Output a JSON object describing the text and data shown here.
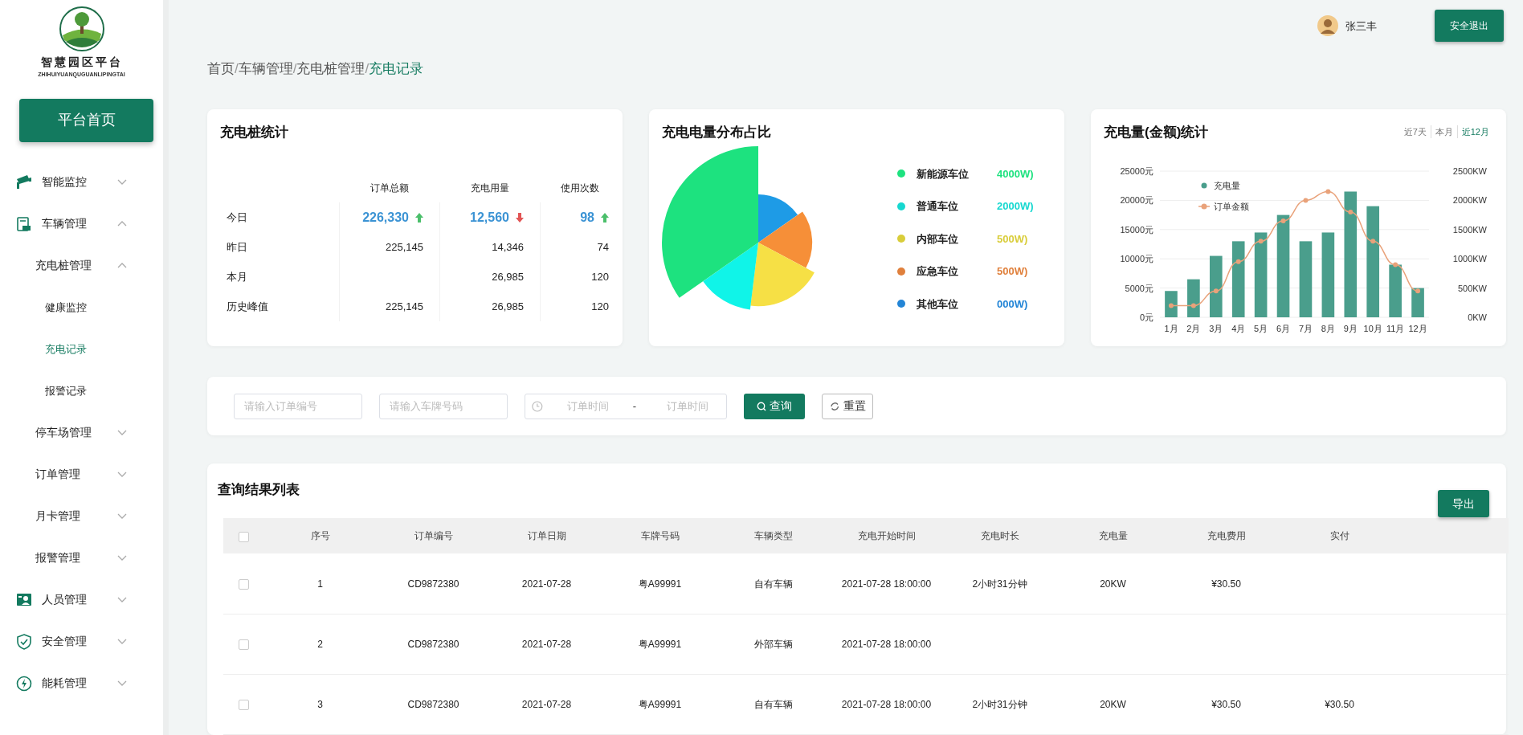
{
  "logo": {
    "title": "智慧园区平台",
    "subtitle": "ZHIHUIYUANQUGUANLIPINGTAI"
  },
  "home_button": "平台首页",
  "sidebar": {
    "items": [
      {
        "label": "智能监控",
        "expanded": false,
        "selected": false
      },
      {
        "label": "车辆管理",
        "expanded": true,
        "selected": false,
        "children": [
          {
            "label": "充电桩管理",
            "expanded": true,
            "selected": false,
            "children": [
              {
                "label": "健康监控",
                "selected": false
              },
              {
                "label": "充电记录",
                "selected": true
              },
              {
                "label": "报警记录",
                "selected": false
              }
            ]
          },
          {
            "label": "停车场管理",
            "expanded": false,
            "selected": false
          },
          {
            "label": "订单管理",
            "expanded": false,
            "selected": false
          },
          {
            "label": "月卡管理",
            "expanded": false,
            "selected": false
          },
          {
            "label": "报警管理",
            "expanded": false,
            "selected": false
          }
        ]
      },
      {
        "label": "人员管理",
        "expanded": false,
        "selected": false
      },
      {
        "label": "安全管理",
        "expanded": false,
        "selected": false
      },
      {
        "label": "能耗管理",
        "expanded": false,
        "selected": false
      }
    ]
  },
  "user": {
    "name": "张三丰",
    "logout": "安全退出"
  },
  "breadcrumb": {
    "separator": "/",
    "items": [
      "首页",
      "车辆管理",
      "充电桩管理",
      "充电记录"
    ]
  },
  "stats": {
    "title": "充电桩统计",
    "columns": [
      "订单总额",
      "充电用量",
      "使用次数"
    ],
    "rows": [
      {
        "label": "今日",
        "highlight": true,
        "cells": [
          {
            "value": "226,330",
            "rising": true
          },
          {
            "value": "12,560",
            "rising": false
          },
          {
            "value": "98",
            "rising": true
          }
        ]
      },
      {
        "label": "昨日",
        "highlight": false,
        "cells": [
          {
            "value": "225,145"
          },
          {
            "value": "14,346"
          },
          {
            "value": "74"
          }
        ]
      },
      {
        "label": "本月",
        "highlight": false,
        "cells": [
          null,
          {
            "value": "26,985"
          },
          {
            "value": "120"
          }
        ]
      },
      {
        "label": "历史峰值",
        "highlight": false,
        "cells": [
          {
            "value": "225,145"
          },
          {
            "value": "26,985"
          },
          {
            "value": "120"
          }
        ]
      }
    ]
  },
  "distribution": {
    "title": "充电电量分布占比",
    "legend": [
      {
        "name": "新能源车位",
        "value": "4000W)",
        "color": "#1de27f"
      },
      {
        "name": "普通车位",
        "value": "2000W)",
        "color": "#16d8d0"
      },
      {
        "name": "内部车位",
        "value": "500W)",
        "color": "#d9cd3a"
      },
      {
        "name": "应急车位",
        "value": "500W)",
        "color": "#e0803c"
      },
      {
        "name": "其他车位",
        "value": "000W)",
        "color": "#2385d6"
      }
    ]
  },
  "trend": {
    "title": "充电量(金额)统计",
    "ranges": [
      {
        "label": "近7天",
        "selected": false
      },
      {
        "label": "本月",
        "selected": false
      },
      {
        "label": "近12月",
        "selected": true
      }
    ],
    "chart_data": {
      "type": "bar",
      "categories": [
        "1月",
        "2月",
        "3月",
        "4月",
        "5月",
        "6月",
        "7月",
        "8月",
        "9月",
        "10月",
        "11月",
        "12月"
      ],
      "series": [
        {
          "name": "充电量",
          "type": "bar",
          "axis": "y2",
          "color": "#4a9e8c",
          "values": [
            450,
            650,
            1050,
            1300,
            1450,
            1750,
            1300,
            1450,
            2150,
            1900,
            900,
            500
          ]
        },
        {
          "name": "订单金额",
          "type": "line",
          "axis": "y",
          "marker": "circle",
          "color": "#e9a27a",
          "values": [
            2000,
            2000,
            4500,
            9500,
            13000,
            16500,
            20000,
            21500,
            18000,
            13000,
            9000,
            4500
          ]
        }
      ],
      "grid": true,
      "legend": "top-left",
      "ylim": [
        0,
        25000
      ],
      "y2lim": [
        0,
        2500
      ],
      "yticks": [
        {
          "value": 0,
          "label": "0元"
        },
        {
          "value": 5000,
          "label": "5000元"
        },
        {
          "value": 10000,
          "label": "10000元"
        },
        {
          "value": 15000,
          "label": "15000元"
        },
        {
          "value": 20000,
          "label": "20000元"
        },
        {
          "value": 25000,
          "label": "25000元"
        }
      ],
      "y2ticks": [
        {
          "value": 0,
          "label": "0KW"
        },
        {
          "value": 500,
          "label": "500KW"
        },
        {
          "value": 1000,
          "label": "1000KW"
        },
        {
          "value": 1500,
          "label": "1500KW"
        },
        {
          "value": 2000,
          "label": "2000KW"
        },
        {
          "value": 2500,
          "label": "2500KW"
        }
      ]
    }
  },
  "filters": {
    "order_no": {
      "placeholder": "请输入订单编号"
    },
    "plate": {
      "placeholder": "请输入车牌号码"
    },
    "date_range": {
      "start_placeholder": "订单时间",
      "separator": "-",
      "end_placeholder": "订单时间"
    },
    "search": "查询",
    "reset": "重置"
  },
  "results": {
    "title": "查询结果列表",
    "export": "导出",
    "all_checked": false,
    "columns": [
      "序号",
      "订单编号",
      "订单日期",
      "车牌号码",
      "车辆类型",
      "充电开始时间",
      "充电时长",
      "充电量",
      "充电费用",
      "实付"
    ],
    "rows": [
      {
        "checked": false,
        "cells": [
          "1",
          "CD9872380",
          "2021-07-28",
          "粤A99991",
          "自有车辆",
          "2021-07-28 18:00:00",
          "2小时31分钟",
          "20KW",
          "¥30.50"
        ]
      },
      {
        "checked": false,
        "cells": [
          "2",
          "CD9872380",
          "2021-07-28",
          "粤A99991",
          "外部车辆",
          "2021-07-28 18:00:00"
        ]
      },
      {
        "checked": false,
        "cells": [
          "3",
          "CD9872380",
          "2021-07-28",
          "粤A99991",
          "自有车辆",
          "2021-07-28 18:00:00",
          "2小时31分钟",
          "20KW",
          "¥30.50",
          "¥30.50"
        ]
      }
    ]
  }
}
